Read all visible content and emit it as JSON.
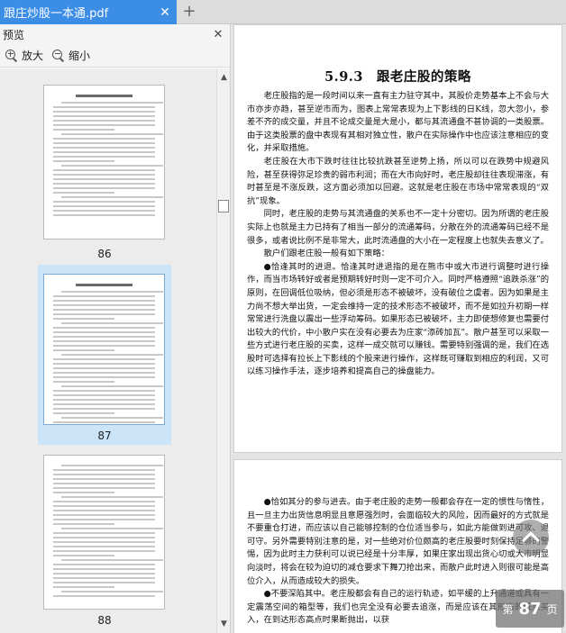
{
  "tab": {
    "title": "跟庄炒股一本通.pdf",
    "close_icon": "close-icon",
    "add_icon": "plus-icon"
  },
  "sidebar": {
    "title": "预览",
    "close_icon": "close-icon",
    "zoom_in_label": "放大",
    "zoom_out_label": "缩小",
    "thumbnails": [
      {
        "page": "86",
        "selected": false
      },
      {
        "page": "87",
        "selected": true
      },
      {
        "page": "88",
        "selected": false
      }
    ]
  },
  "document": {
    "section_title": "5.9.3　跟老庄股的策略",
    "page1_paragraphs": [
      "老庄股指的是一段时间以来一直有主力驻守其中，其股价走势基本上不会与大市亦步亦趋，甚至逆市而为，图表上常常表现为上下影线的日K线，忽大忽小，参差不齐的成交量，并且不论成交量是大是小，都与其流通盘不甚协调的一类股票。由于这类股票的盘中表现有其相对独立性，散户在实际操作中也应该注意相应的变化，并采取措施。",
      "老庄股在大市下跌时往往比较抗跌甚至逆势上扬，所以可以在跌势中规避风险，甚至获得弥足珍贵的弱市利润；而在大市向好时，老庄股却往往表现滞涨，有时甚至是不涨反跌，这方面必须加以回避。这就是老庄股在市场中常常表现的“双抗”现象。",
      "同时，老庄股的走势与其流通盘的关系也不一定十分密切。因为所谓的老庄股实际上也就是主力已持有了相当一部分的流通筹码，分散在外的流通筹码已经不是很多，或者说比例不是非常大，此时流通盘的大小在一定程度上也就失去意义了。",
      "散户们跟老庄股一般有如下策略：",
      "●恰逢其时的进退。恰逢其时进退指的是在熊市中或大市进行调整时进行操作，而当市场转好或者是预期转好时则一定不可介入。同时严格遵照“追跌杀涨”的原则，在回调低位吸纳，但必须是形态不被破坏，没有破位之虞者。因为如果是主力尚不想大举出货，一定会维持一定的技术形态不被破坏，而不是如拉升初期一样常常进行洗盘以震出一些浮动筹码。如果形态已被破坏，主力即使想修复也需要付出较大的代价，中小散户实在没有必要去为庄家“添砖加瓦”。散户甚至可以采取一些方式进行老庄股的买卖，这样一成交就可以赚钱。需要特别强调的是，我们在选股时可选择有拉长上下影线的个股来进行操作，这样既可赚取到相应的利润，又可以练习操作手法，逐步培养和提高自己的操盘能力。"
    ],
    "page2_paragraphs": [
      "●恰如其分的参与进去。由于老庄股的走势一般都会存在一定的惯性与惰性，且一旦主力出货信息明显且意愿强烈时，会面临较大的风险，因而最好的方式就是不要重仓打进，而应该以自己能够控制的仓位适当参与，如此方能做到进可攻、退可守。另外需要特别注意的是，对一些绝对价位颇高的老庄股要时刻保持足够的警惕，因为此时主力获利可以说已经是十分丰厚，如果庄家出现出货心切或大市明显向淡时，将会在较为迫切的减仓要求下舞刀抢出来，而散户此时进入则很可能是高位介入，从而造成较大的损失。",
      "●不要深陷其中。老庄股都会有自己的运行轨迹，如平缓的上升通道或具有一定震荡空间的箱型等，我们也完全没有必要去追涨，而是应该在其形态的低点买入，在到达形态高点时果断抛出，以获"
    ]
  },
  "controls": {
    "scroll_top_icon": "chevron-up-icon",
    "page_prefix": "第",
    "page_number": "87",
    "page_suffix": "页"
  }
}
